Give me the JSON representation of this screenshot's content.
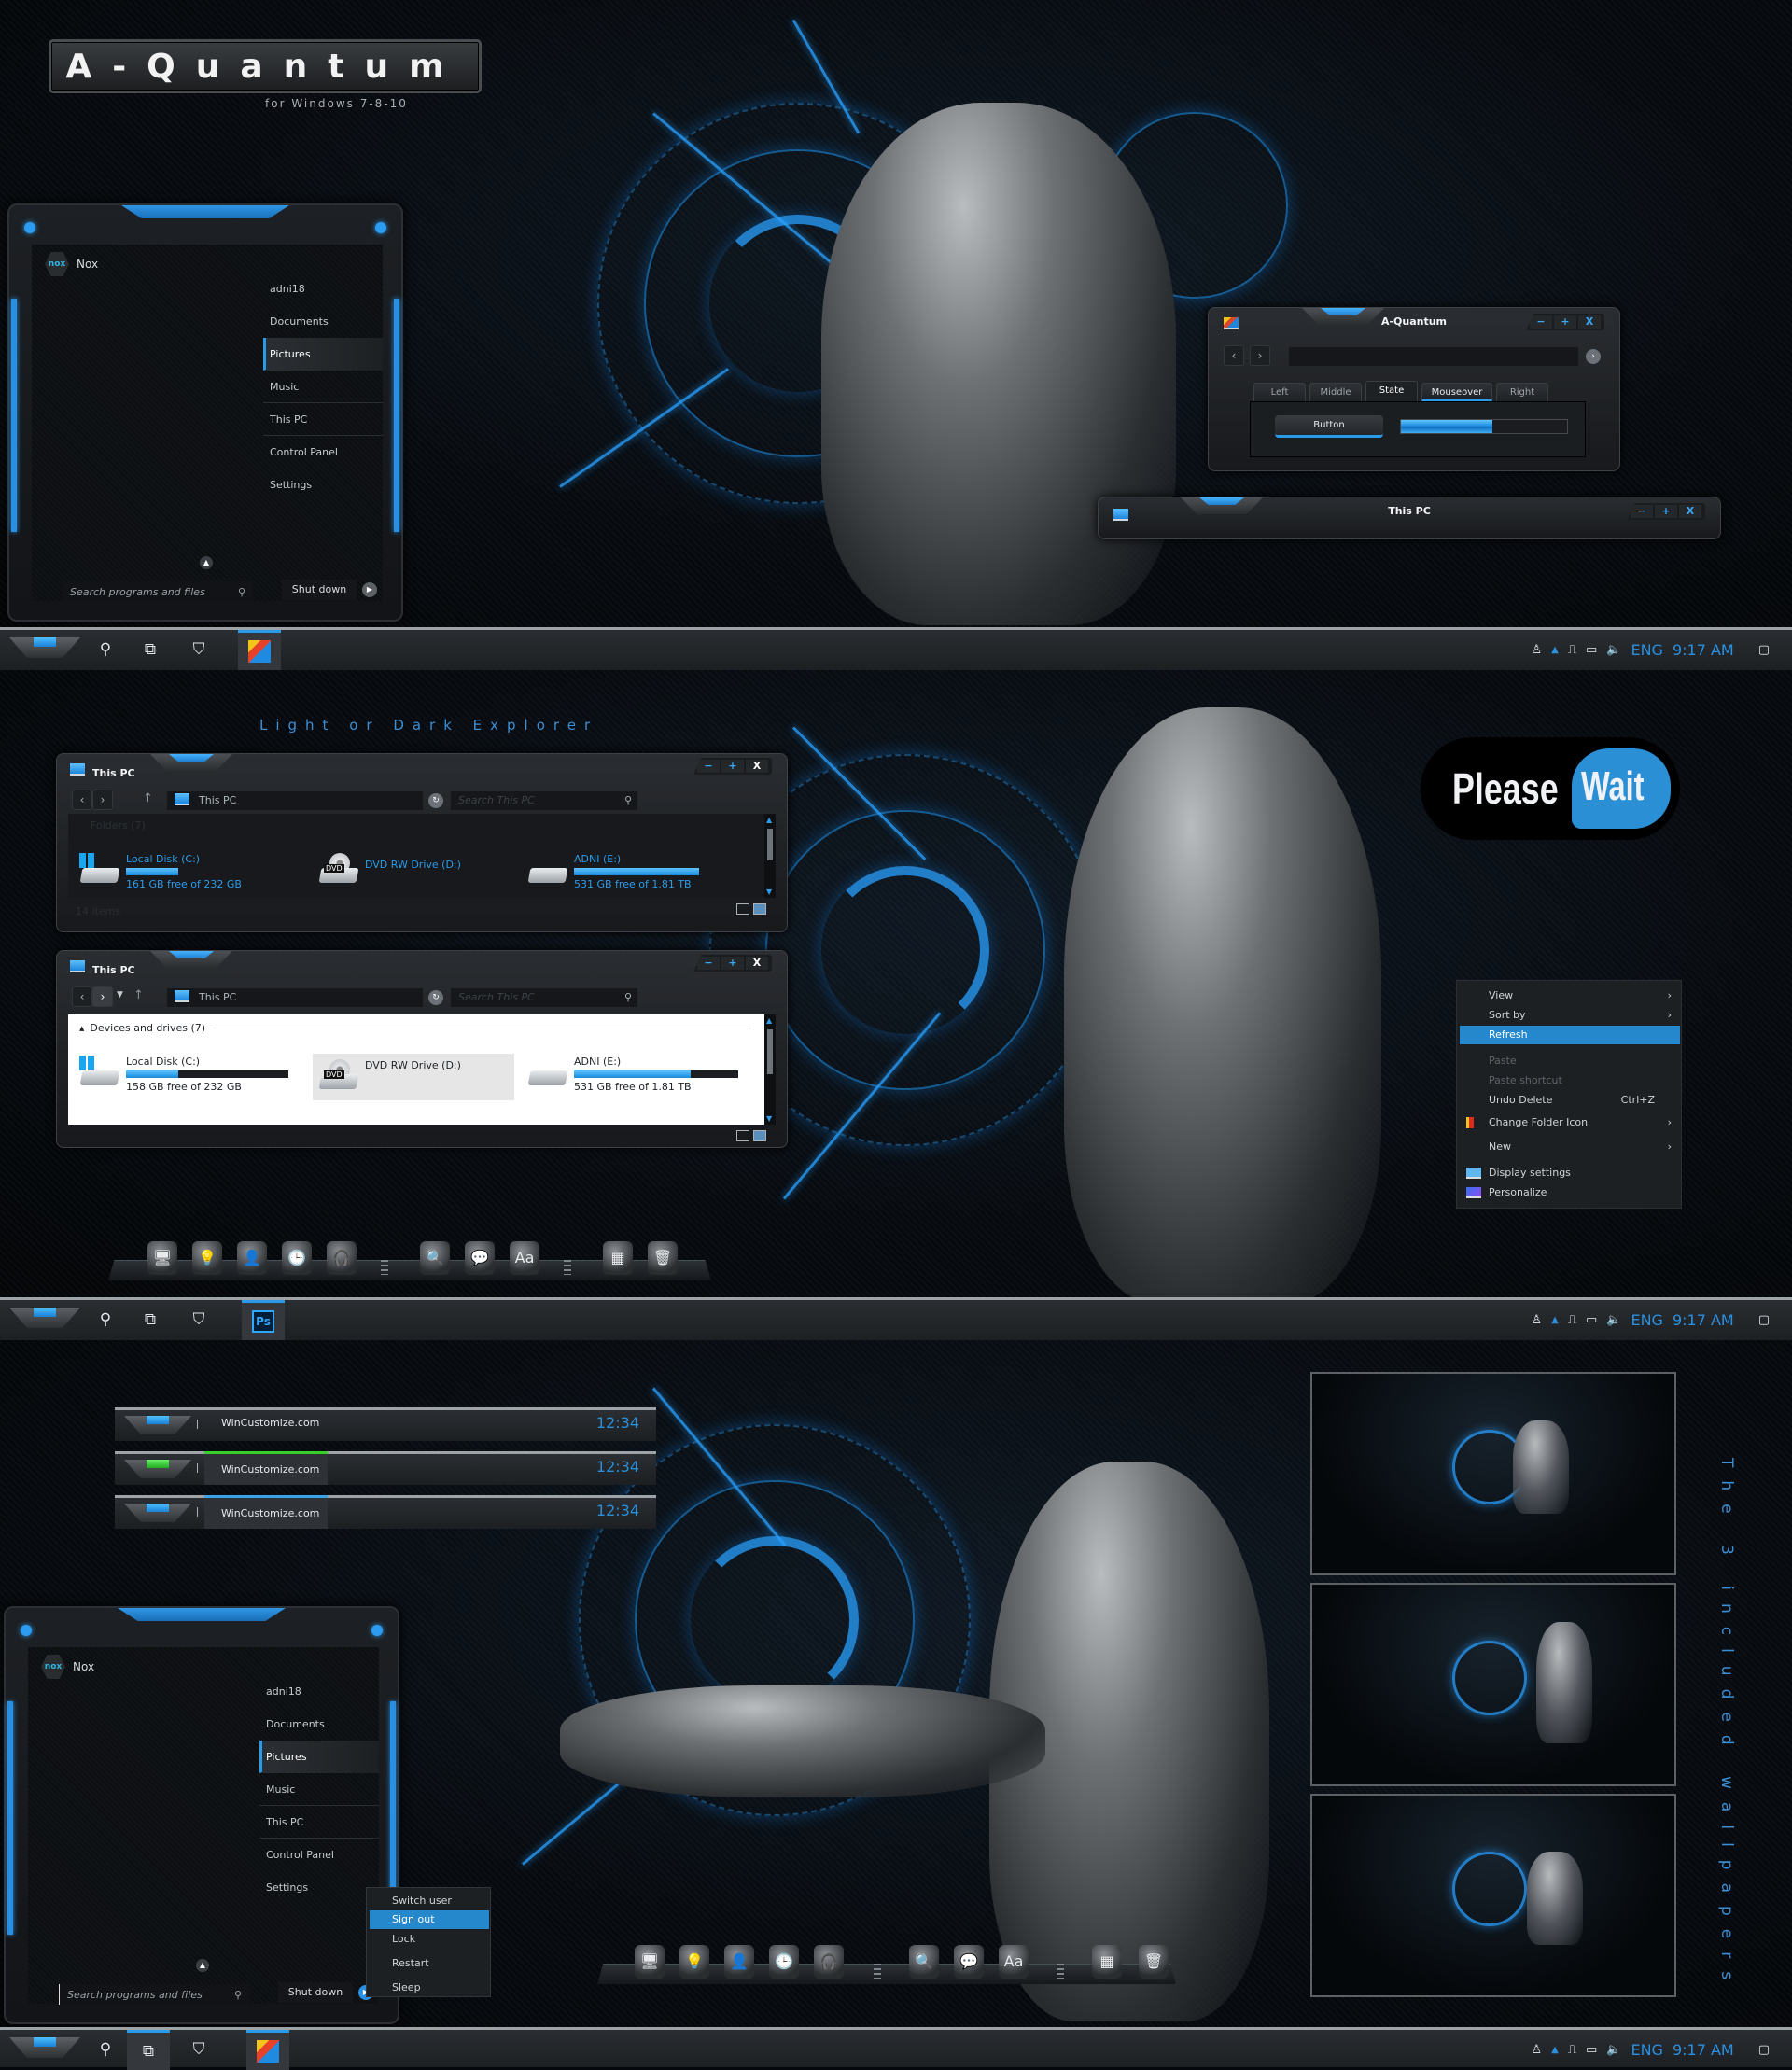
{
  "branding": {
    "title": "A-Quantum",
    "subtitle": "for Windows 7-8-10"
  },
  "start_menu": {
    "user_tile": "Nox",
    "user_badge": "nox",
    "items": [
      "adni18",
      "Documents",
      "Pictures",
      "Music",
      "This PC",
      "Control Panel",
      "Settings"
    ],
    "active_item": "Pictures",
    "search_placeholder": "Search programs and files",
    "shutdown_label": "Shut down",
    "power_submenu": [
      "Switch user",
      "Sign out",
      "Lock",
      "Restart",
      "Sleep"
    ],
    "power_submenu_highlight": "Sign out"
  },
  "quantum_window": {
    "title": "A-Quantum",
    "controls": [
      "−",
      "+",
      "X"
    ],
    "tabs": [
      "Left",
      "Middle",
      "State",
      "Mouseover",
      "Right"
    ],
    "active_tab": "State",
    "hover_tab": "Mouseover",
    "button_label": "Button",
    "progress": 0.55
  },
  "this_pc_collapsed": {
    "title": "This PC",
    "controls": [
      "−",
      "+",
      "X"
    ]
  },
  "taskbar": {
    "icons": [
      "start-orb",
      "search",
      "task-view",
      "defender-shield"
    ],
    "tray": {
      "people": "♙",
      "upload": "▲",
      "usb": "⎍",
      "network": "▭",
      "volume": "🔈",
      "language": "ENG",
      "time": "9:17 AM",
      "notifications": "▢"
    },
    "pinned_apps": [
      "file-explorer",
      "photoshop",
      "file-explorer"
    ],
    "ps_label": "Ps"
  },
  "explorer_section": {
    "heading": "Light or Dark Explorer",
    "dark_window": {
      "title": "This PC",
      "address": "This PC",
      "search_placeholder": "Search This PC",
      "group_header": "Folders (7)",
      "status": "14 items",
      "drives": [
        {
          "name": "Local Disk (C:)",
          "free": "161 GB free of 232 GB",
          "used_fraction": 0.31
        },
        {
          "name": "DVD RW Drive (D:)",
          "free": "",
          "used_fraction": null
        },
        {
          "name": "ADNI (E:)",
          "free": "531 GB free of 1.81 TB",
          "used_fraction": 0.71
        }
      ]
    },
    "light_window": {
      "title": "This PC",
      "address": "This PC",
      "search_placeholder": "Search This PC",
      "group_header": "Devices and drives (7)",
      "drives": [
        {
          "name": "Local Disk (C:)",
          "free": "158 GB free of 232 GB",
          "used_fraction": 0.32
        },
        {
          "name": "DVD RW Drive (D:)",
          "free": "",
          "used_fraction": null
        },
        {
          "name": "ADNI (E:)",
          "free": "531 GB free of 1.81 TB",
          "used_fraction": 0.71
        }
      ],
      "selected_drive": "DVD RW Drive (D:)"
    }
  },
  "please_wait": {
    "word1": "Please",
    "word2": "Wait"
  },
  "context_menu": {
    "items": [
      {
        "label": "View",
        "submenu": true
      },
      {
        "label": "Sort by",
        "submenu": true
      },
      {
        "label": "Refresh",
        "highlight": true
      },
      {
        "label": "Paste",
        "disabled": true
      },
      {
        "label": "Paste shortcut",
        "disabled": true
      },
      {
        "label": "Undo Delete",
        "shortcut": "Ctrl+Z"
      },
      {
        "label": "Change Folder Icon",
        "submenu": true,
        "icon": "folder-color-icon"
      },
      {
        "label": "New",
        "submenu": true
      },
      {
        "label": "Display settings",
        "icon": "display-icon"
      },
      {
        "label": "Personalize",
        "icon": "personalize-icon"
      }
    ]
  },
  "dock": {
    "icons": [
      "computer",
      "lightbulb",
      "user",
      "clock",
      "headphones",
      "magnifier",
      "messenger",
      "font-book",
      "calculator",
      "recycle-bin"
    ]
  },
  "taskbar_previews": [
    {
      "label": "WinCustomize.com",
      "clock": "12:34",
      "state": "normal"
    },
    {
      "label": "WinCustomize.com",
      "clock": "12:34",
      "state": "active-green"
    },
    {
      "label": "WinCustomize.com",
      "clock": "12:34",
      "state": "active-blue"
    }
  ],
  "wallpapers": {
    "caption": "The 3 included wallpapers",
    "count": 3
  },
  "colors": {
    "accent": "#2a9be8",
    "highlight": "#2588cc",
    "green_accent": "#36d02a",
    "background": "#05080c"
  }
}
